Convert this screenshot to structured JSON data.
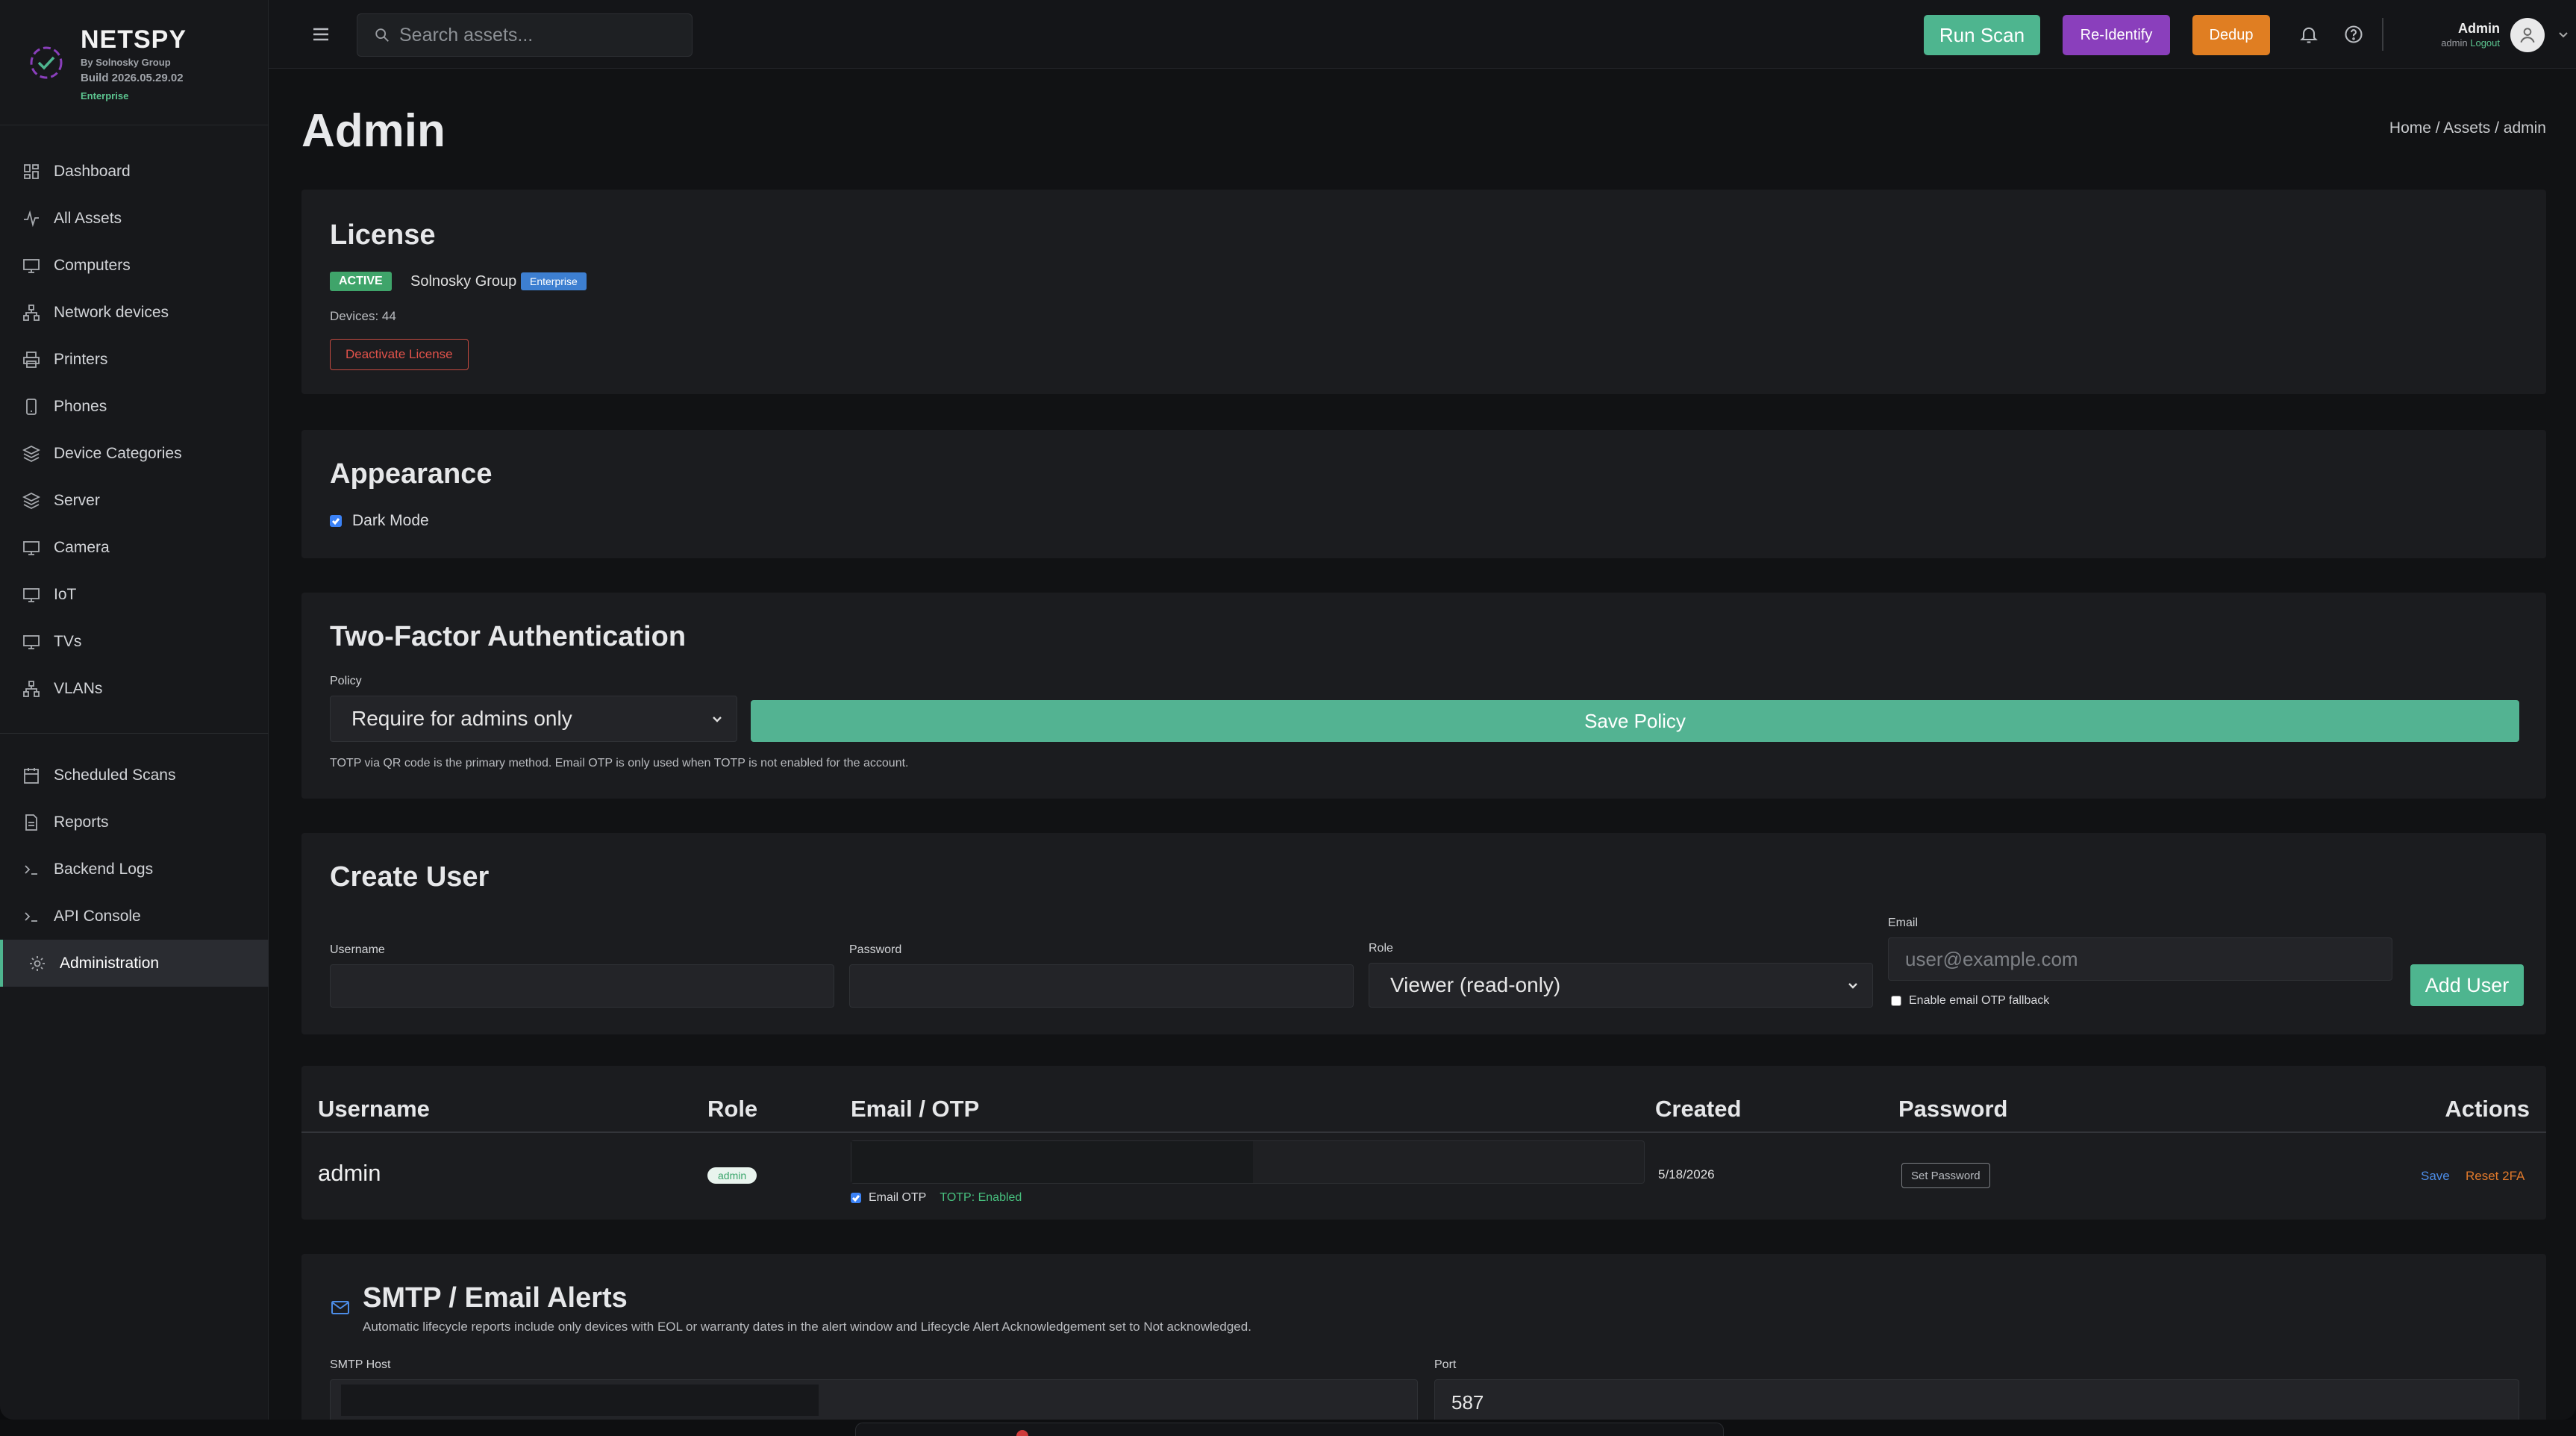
{
  "brand": {
    "title": "NETSPY",
    "subtitle": "By Solnosky Group",
    "build": "Build 2026.05.29.02",
    "edition": "Enterprise"
  },
  "sidebar": {
    "items": [
      {
        "label": "Dashboard",
        "icon": "dashboard-icon"
      },
      {
        "label": "All Assets",
        "icon": "activity-icon"
      },
      {
        "label": "Computers",
        "icon": "monitor-icon"
      },
      {
        "label": "Network devices",
        "icon": "network-icon"
      },
      {
        "label": "Printers",
        "icon": "printer-icon"
      },
      {
        "label": "Phones",
        "icon": "phone-icon"
      },
      {
        "label": "Device Categories",
        "icon": "layers-icon"
      },
      {
        "label": "Server",
        "icon": "layers-icon"
      },
      {
        "label": "Camera",
        "icon": "monitor-icon"
      },
      {
        "label": "IoT",
        "icon": "monitor-icon"
      },
      {
        "label": "TVs",
        "icon": "monitor-icon"
      },
      {
        "label": "VLANs",
        "icon": "network-icon"
      }
    ],
    "items2": [
      {
        "label": "Scheduled Scans",
        "icon": "calendar-icon"
      },
      {
        "label": "Reports",
        "icon": "file-icon"
      },
      {
        "label": "Backend Logs",
        "icon": "terminal-icon"
      },
      {
        "label": "API Console",
        "icon": "terminal-icon"
      },
      {
        "label": "Administration",
        "icon": "gear-icon",
        "active": true
      }
    ]
  },
  "topbar": {
    "search_placeholder": "Search assets...",
    "run_scan": "Run Scan",
    "reidentify": "Re-Identify",
    "dedup": "Dedup",
    "user_name": "Admin",
    "user_role": "admin",
    "logout": "Logout"
  },
  "page": {
    "title": "Admin",
    "breadcrumb": "Home / Assets / admin"
  },
  "license": {
    "heading": "License",
    "status": "ACTIVE",
    "org": "Solnosky Group",
    "edition": "Enterprise",
    "devices": "Devices: 44",
    "deactivate": "Deactivate License"
  },
  "appearance": {
    "heading": "Appearance",
    "dark_mode": "Dark Mode",
    "dark_mode_checked": true
  },
  "twofa": {
    "heading": "Two-Factor Authentication",
    "policy_label": "Policy",
    "policy_value": "Require for admins only",
    "save": "Save Policy",
    "help": "TOTP via QR code is the primary method. Email OTP is only used when TOTP is not enabled for the account."
  },
  "create_user": {
    "heading": "Create User",
    "username_label": "Username",
    "username_value": "",
    "password_label": "Password",
    "password_value": "",
    "role_label": "Role",
    "role_value": "Viewer (read-only)",
    "email_label": "Email",
    "email_placeholder": "user@example.com",
    "otp_fallback": "Enable email OTP fallback",
    "add": "Add User"
  },
  "users_table": {
    "columns": [
      "Username",
      "Role",
      "Email / OTP",
      "Created",
      "Password",
      "Actions"
    ],
    "rows": [
      {
        "username": "admin",
        "role": "admin",
        "email_otp_label": "Email OTP",
        "totp": "TOTP: Enabled",
        "created": "5/18/2026",
        "set_password": "Set Password",
        "save": "Save",
        "reset_2fa": "Reset 2FA"
      }
    ]
  },
  "smtp": {
    "heading": "SMTP / Email Alerts",
    "desc": "Automatic lifecycle reports include only devices with EOL or warranty dates in the alert window and Lifecycle Alert Acknowledgement set to Not acknowledged.",
    "host_label": "SMTP Host",
    "host_value": "",
    "port_label": "Port",
    "port_value": "587"
  },
  "colors": {
    "accent": "#4eb58f",
    "purple": "#8a3fbc",
    "orange": "#e07e22",
    "danger": "#e0524a",
    "link": "#4c8ce6"
  }
}
